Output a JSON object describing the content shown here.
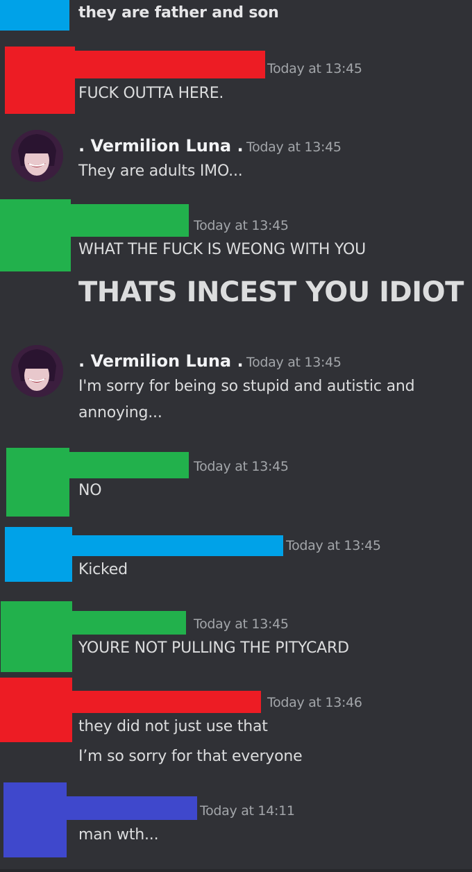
{
  "colors": {
    "background": "#303136",
    "blue": "#00a2e8",
    "red": "#ed1c24",
    "green": "#22b14c",
    "indigo": "#3f48cc",
    "text": "#dcddde",
    "timestamp": "#a3a6aa"
  },
  "messages": [
    {
      "text": "they are father and son"
    },
    {
      "timestamp": "Today at 13:45",
      "text": "FUCK OUTTA HERE."
    },
    {
      "author": ". Vermilion Luna .",
      "timestamp": "Today at 13:45",
      "text": "They are adults IMO..."
    },
    {
      "timestamp": "Today at 13:45",
      "text": "WHAT THE FUCK IS WEONG WITH YOU",
      "big_text": "THATS INCEST YOU IDIOT"
    },
    {
      "author": ". Vermilion Luna .",
      "timestamp": "Today at 13:45",
      "lines": [
        "I'm sorry for being so stupid and autistic and",
        "annoying..."
      ]
    },
    {
      "timestamp": "Today at 13:45",
      "text": "NO"
    },
    {
      "timestamp": "Today at 13:45",
      "text": "Kicked"
    },
    {
      "timestamp": "Today at 13:45",
      "text": "YOURE NOT PULLING THE PITYCARD"
    },
    {
      "timestamp": "Today at 13:46",
      "lines": [
        "they did not just use that",
        "I’m so sorry for that everyone"
      ]
    },
    {
      "timestamp": "Today at 14:11",
      "text": "man wth..."
    }
  ]
}
